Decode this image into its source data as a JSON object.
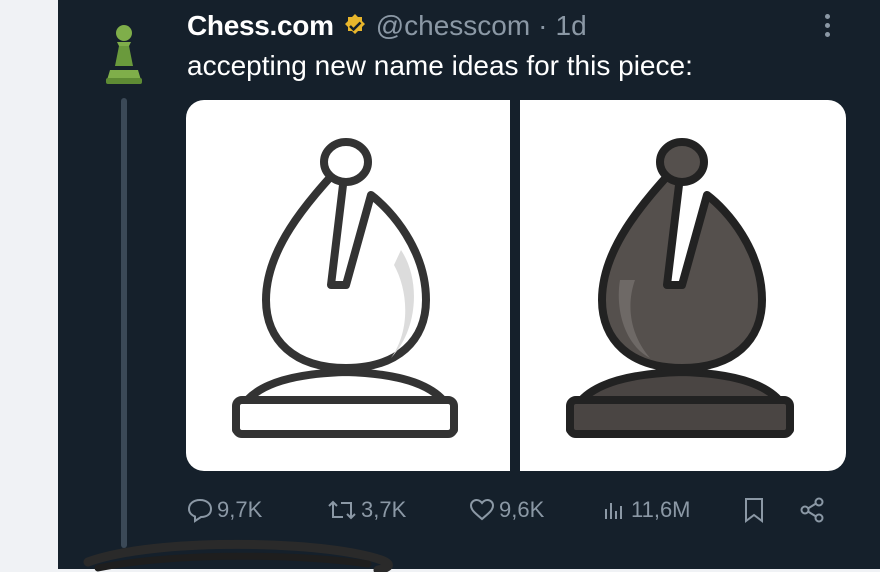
{
  "tweet": {
    "author_name": "Chess.com",
    "handle": "@chesscom",
    "separator": "·",
    "time": "1d",
    "text": "accepting new name ideas for this piece:",
    "verified_color": "#e8b62c",
    "avatar_icon": "green-pawn-icon",
    "media": {
      "left_piece": "white-bishop-illustration",
      "right_piece": "dark-bishop-illustration"
    }
  },
  "actions": {
    "replies": "9,7K",
    "reposts": "3,7K",
    "likes": "9,6K",
    "views": "11,6M"
  },
  "colors": {
    "background": "#15202b",
    "text": "#ffffff",
    "muted": "#8b98a5",
    "pawn_green": "#7fae4a"
  }
}
